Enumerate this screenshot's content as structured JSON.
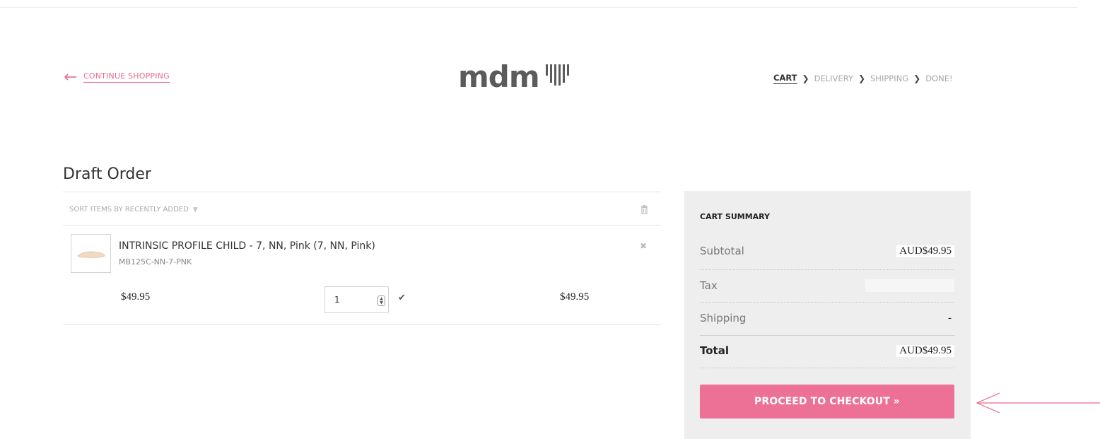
{
  "header": {
    "continue_label": "CONTINUE SHOPPING",
    "logo_text": "mdm",
    "steps": [
      {
        "label": "CART",
        "active": true
      },
      {
        "label": "DELIVERY",
        "active": false
      },
      {
        "label": "SHIPPING",
        "active": false
      },
      {
        "label": "DONE!",
        "active": false
      }
    ]
  },
  "cart": {
    "title": "Draft Order",
    "sort_label": "SORT ITEMS BY RECENTLY ADDED",
    "items": [
      {
        "name": "INTRINSIC PROFILE CHILD - 7, NN, Pink (7, NN, Pink)",
        "sku": "MB125C-NN-7-PNK",
        "price": "$49.95",
        "quantity": "1",
        "line_total": "$49.95"
      }
    ]
  },
  "summary": {
    "title": "CART SUMMARY",
    "subtotal_label": "Subtotal",
    "subtotal_value": "AUD$49.95",
    "tax_label": "Tax",
    "shipping_label": "Shipping",
    "shipping_value": "-",
    "total_label": "Total",
    "total_value": "AUD$49.95",
    "checkout_label": "PROCEED TO CHECKOUT »"
  },
  "colors": {
    "accent": "#ed7096",
    "link": "#ea6a8c",
    "panel": "#eeeeee"
  }
}
